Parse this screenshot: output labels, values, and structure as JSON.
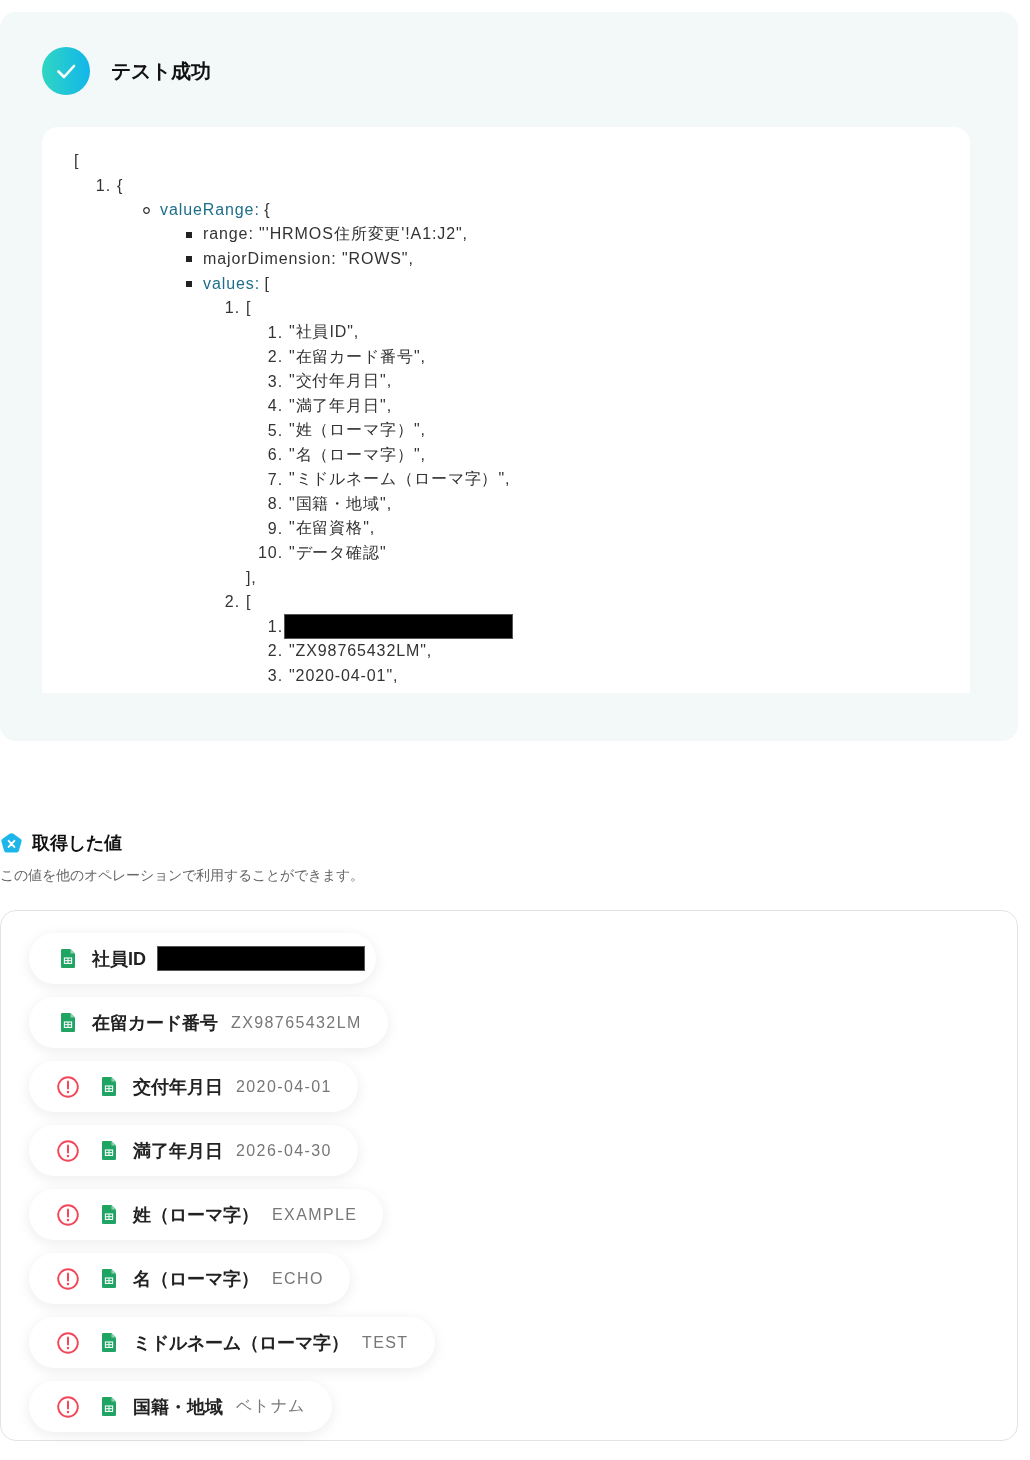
{
  "test_result": {
    "title": "テスト成功"
  },
  "output": {
    "open": "[",
    "items": [
      {
        "kind": "number",
        "marker": "1.",
        "text": "{",
        "redacted": false,
        "children": [
          {
            "kind": "circle",
            "key": "valueRange:",
            "text": "{",
            "redacted": false,
            "children": [
              {
                "kind": "square",
                "text": "range: \"'HRMOS住所変更'!A1:J2\",",
                "redacted": false
              },
              {
                "kind": "square",
                "text": "majorDimension: \"ROWS\",",
                "redacted": false
              },
              {
                "kind": "square",
                "key": "values:",
                "text": "[",
                "redacted": false,
                "children": [
                  {
                    "kind": "number",
                    "marker": "1.",
                    "text": "[",
                    "redacted": false,
                    "close": "],",
                    "children": [
                      {
                        "kind": "number",
                        "marker": "1.",
                        "text": "\"社員ID\",",
                        "redacted": false
                      },
                      {
                        "kind": "number",
                        "marker": "2.",
                        "text": "\"在留カード番号\",",
                        "redacted": false
                      },
                      {
                        "kind": "number",
                        "marker": "3.",
                        "text": "\"交付年月日\",",
                        "redacted": false
                      },
                      {
                        "kind": "number",
                        "marker": "4.",
                        "text": "\"満了年月日\",",
                        "redacted": false
                      },
                      {
                        "kind": "number",
                        "marker": "5.",
                        "text": "\"姓（ローマ字）\",",
                        "redacted": false
                      },
                      {
                        "kind": "number",
                        "marker": "6.",
                        "text": "\"名（ローマ字）\",",
                        "redacted": false
                      },
                      {
                        "kind": "number",
                        "marker": "7.",
                        "text": "\"ミドルネーム（ローマ字）\",",
                        "redacted": false
                      },
                      {
                        "kind": "number",
                        "marker": "8.",
                        "text": "\"国籍・地域\",",
                        "redacted": false
                      },
                      {
                        "kind": "number",
                        "marker": "9.",
                        "text": "\"在留資格\",",
                        "redacted": false
                      },
                      {
                        "kind": "number",
                        "marker": "10.",
                        "text": "\"データ確認\"",
                        "redacted": false
                      }
                    ]
                  },
                  {
                    "kind": "number",
                    "marker": "2.",
                    "text": "[",
                    "redacted": false,
                    "children": [
                      {
                        "kind": "number",
                        "marker": "1.",
                        "redacted": true
                      },
                      {
                        "kind": "number",
                        "marker": "2.",
                        "text": "\"ZX98765432LM\",",
                        "redacted": false
                      },
                      {
                        "kind": "number",
                        "marker": "3.",
                        "text": "\"2020-04-01\",",
                        "redacted": false
                      }
                    ]
                  }
                ]
              }
            ]
          }
        ]
      }
    ]
  },
  "acquired_values": {
    "title": "取得した値",
    "description": "この値を他のオペレーションで利用することができます。",
    "items": [
      {
        "label": "社員ID",
        "warning": false,
        "redacted": true
      },
      {
        "label": "在留カード番号",
        "value": "ZX98765432LM",
        "warning": false,
        "redacted": false
      },
      {
        "label": "交付年月日",
        "value": "2020-04-01",
        "warning": true,
        "redacted": false
      },
      {
        "label": "満了年月日",
        "value": "2026-04-30",
        "warning": true,
        "redacted": false
      },
      {
        "label": "姓（ローマ字）",
        "value": "EXAMPLE",
        "warning": true,
        "redacted": false
      },
      {
        "label": "名（ローマ字）",
        "value": "ECHO",
        "warning": true,
        "redacted": false
      },
      {
        "label": "ミドルネーム（ローマ字）",
        "value": "TEST",
        "warning": true,
        "redacted": false
      },
      {
        "label": "国籍・地域",
        "value": "ベトナム",
        "warning": true,
        "redacted": false
      }
    ]
  }
}
